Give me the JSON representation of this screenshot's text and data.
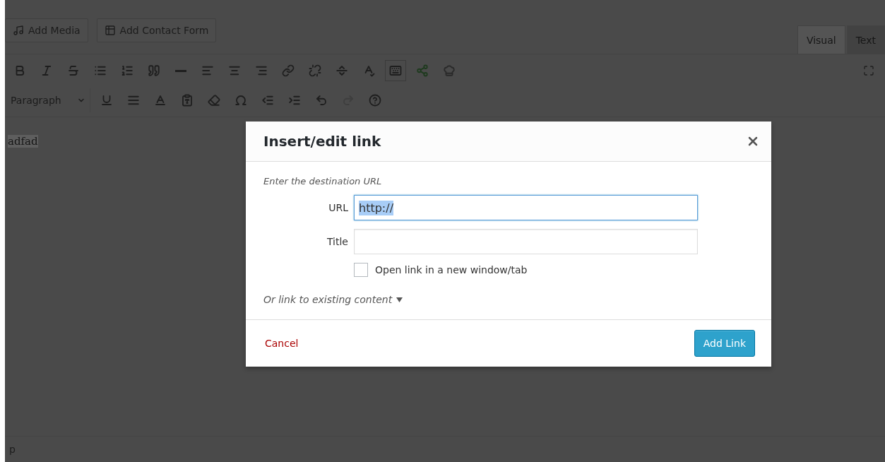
{
  "media_buttons": [
    {
      "label": "Add Media"
    },
    {
      "label": "Add Contact Form"
    }
  ],
  "editor_tabs": [
    {
      "label": "Visual",
      "selected": true
    },
    {
      "label": "Text",
      "selected": false
    }
  ],
  "toolbar": {
    "row_1": [
      {
        "pressed": false
      },
      {
        "pressed": false
      },
      {
        "pressed": false
      },
      {
        "pressed": false
      },
      {
        "pressed": false
      },
      {
        "pressed": false
      },
      {
        "pressed": false
      },
      {
        "pressed": false
      },
      {
        "pressed": false
      },
      {
        "pressed": false
      },
      {
        "pressed": false
      },
      {
        "pressed": false
      },
      {
        "pressed": false
      },
      {
        "pressed": false
      },
      {
        "pressed": true
      },
      {
        "pressed": false
      },
      {
        "pressed": false
      }
    ],
    "format_select": "Paragraph",
    "row_2": [
      {
        "disabled": false
      },
      {
        "disabled": false
      },
      {
        "disabled": false
      },
      {
        "disabled": false
      },
      {
        "disabled": false
      },
      {
        "disabled": false
      },
      {
        "disabled": false
      },
      {
        "disabled": false
      },
      {
        "disabled": false
      },
      {
        "disabled": true
      },
      {
        "disabled": false
      }
    ]
  },
  "editor": {
    "content": "adfad",
    "content_selected": true,
    "status_path": "p"
  },
  "dialog": {
    "title": "Insert/edit link",
    "instruction": "Enter the destination URL",
    "fields": [
      {
        "label": "URL",
        "value": "http://",
        "value_selected": true,
        "focused": true
      },
      {
        "label": "Title",
        "focused": false
      }
    ],
    "new_window": {
      "label": "Open link in a new window/tab",
      "checked": false
    },
    "existing_content": {
      "label": "Or link to existing content",
      "expanded": false
    },
    "cancel": "Cancel",
    "submit": "Add Link"
  }
}
